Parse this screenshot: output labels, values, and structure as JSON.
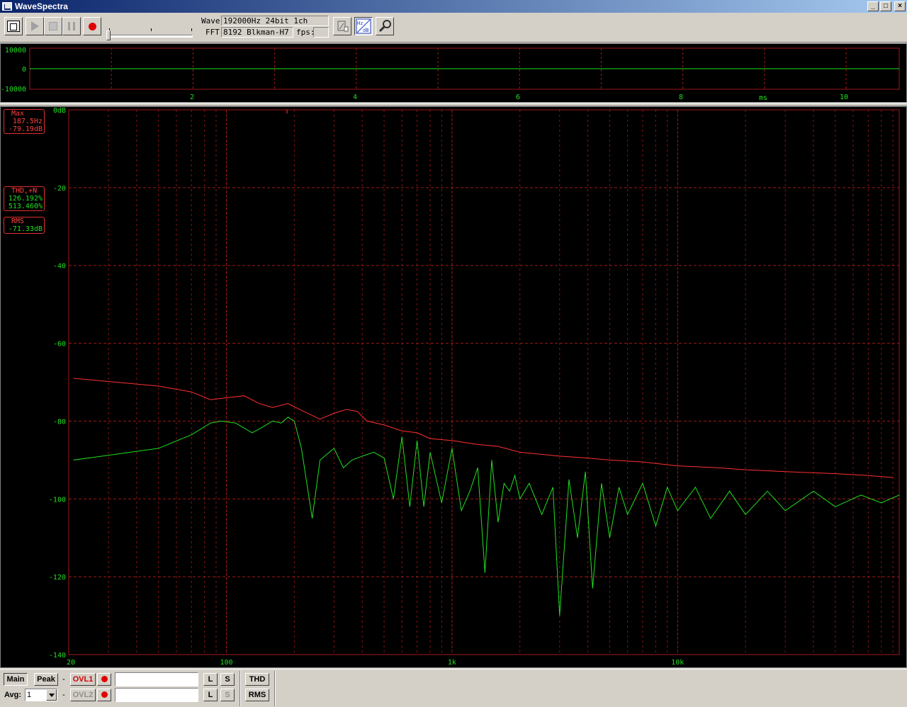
{
  "window": {
    "title": "WaveSpectra"
  },
  "toolbar": {
    "wave_label": "Wave:",
    "wave_value": "192000Hz 24bit 1ch",
    "fft_label": "FFT:",
    "fft_value": "8192 Blkman-H7",
    "fps_label": "fps:",
    "fps_value": ""
  },
  "wave_panel": {
    "y_ticks": [
      "10000",
      "0",
      "-10000"
    ],
    "x_ticks": [
      "2",
      "4",
      "6",
      "8",
      "10"
    ],
    "x_unit": "ms"
  },
  "readouts": {
    "max": {
      "label": "Max",
      "freq": "187.5Hz",
      "level": "-79.19dB"
    },
    "thd": {
      "label": "THD,+N",
      "thd": "126.192%",
      "thdn": "513.460%"
    },
    "rms": {
      "label": "RMS",
      "level": "-71.33dB"
    }
  },
  "bottom": {
    "main_label": "Main",
    "peak_label": "Peak",
    "ovl1_label": "OVL1",
    "ovl2_label": "OVL2",
    "avg_label": "Avg:",
    "avg_value": "1",
    "l_label": "L",
    "s_label": "S",
    "thd_label": "THD",
    "rms_label": "RMS",
    "dash": "-"
  },
  "colors": {
    "grid": "#a01818",
    "trace_max": "#ff3030",
    "trace_main": "#20e020",
    "axis_text": "#20e020",
    "readout_text": "#ff4040"
  },
  "chart_data": {
    "type": "line",
    "title": "",
    "xlabel": "",
    "ylabel": "",
    "x_scale": "log",
    "xlim": [
      20,
      96000
    ],
    "ylim": [
      -140,
      0
    ],
    "x_tick_labels": [
      "20",
      "100",
      "1k",
      "10k"
    ],
    "y_tick_labels": [
      "0dB",
      "-20",
      "-40",
      "-60",
      "-80",
      "-100",
      "-120",
      "-140"
    ],
    "grid": true,
    "series": [
      {
        "color": "#ff3030",
        "x": [
          21,
          50,
          70,
          85,
          100,
          120,
          140,
          160,
          187.5,
          220,
          260,
          300,
          340,
          380,
          420,
          500,
          600,
          700,
          800,
          1000,
          1300,
          1600,
          2000,
          3000,
          4000,
          5000,
          7000,
          10000,
          15000,
          20000,
          30000,
          50000,
          70000,
          90000
        ],
        "y": [
          -69,
          -71,
          -72.5,
          -74.5,
          -74,
          -73.5,
          -75.5,
          -76.5,
          -75.5,
          -77.5,
          -79.5,
          -78,
          -77,
          -77.5,
          -80,
          -81,
          -82.5,
          -83,
          -84.5,
          -85,
          -86,
          -86.5,
          -88,
          -89,
          -89.5,
          -90,
          -90.5,
          -91.5,
          -92,
          -92.5,
          -93,
          -93.5,
          -94,
          -94.5
        ]
      },
      {
        "color": "#20e020",
        "x": [
          21,
          50,
          70,
          85,
          95,
          110,
          130,
          145,
          160,
          175,
          187.5,
          200,
          215,
          240,
          260,
          300,
          330,
          360,
          400,
          450,
          500,
          550,
          600,
          650,
          700,
          750,
          800,
          900,
          1000,
          1100,
          1200,
          1300,
          1400,
          1500,
          1600,
          1700,
          1800,
          1900,
          2000,
          2200,
          2500,
          2800,
          3000,
          3300,
          3600,
          3900,
          4200,
          4600,
          5000,
          5500,
          6000,
          7000,
          8000,
          9000,
          10000,
          12000,
          14000,
          17000,
          20000,
          25000,
          30000,
          40000,
          50000,
          65000,
          80000,
          96000
        ],
        "y": [
          -90,
          -87,
          -83.5,
          -80.5,
          -80,
          -80.5,
          -83,
          -81.5,
          -80,
          -80.5,
          -79,
          -80,
          -87,
          -105,
          -90,
          -87,
          -92,
          -90,
          -89,
          -88,
          -89.5,
          -100,
          -84,
          -102,
          -85,
          -102,
          -88,
          -101,
          -87,
          -103,
          -98,
          -92,
          -119,
          -90,
          -106,
          -96,
          -98,
          -94,
          -100,
          -96,
          -104,
          -97,
          -130,
          -95,
          -110,
          -93,
          -123,
          -96,
          -110,
          -97,
          -104,
          -96,
          -107,
          -97,
          -103,
          -97,
          -105,
          -98,
          -104,
          -98,
          -103,
          -98,
          -102,
          -99,
          -101,
          -99
        ]
      }
    ]
  }
}
